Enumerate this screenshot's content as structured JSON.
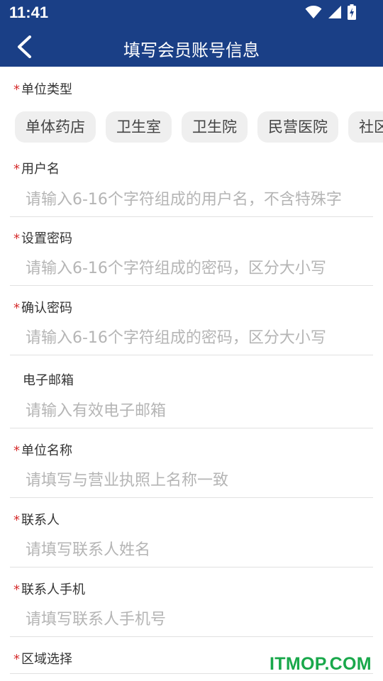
{
  "status": {
    "time": "11:41"
  },
  "header": {
    "title": "填写会员账号信息"
  },
  "form": {
    "unit_type": {
      "label": "单位类型",
      "options": [
        "单体药店",
        "卫生室",
        "卫生院",
        "民营医院",
        "社区"
      ]
    },
    "username": {
      "label": "用户名",
      "placeholder": "请输入6-16个字符组成的用户名，不含特殊字"
    },
    "password": {
      "label": "设置密码",
      "placeholder": "请输入6-16个字符组成的密码，区分大小写"
    },
    "confirm_password": {
      "label": "确认密码",
      "placeholder": "请输入6-16个字符组成的密码，区分大小写"
    },
    "email": {
      "label": "电子邮箱",
      "placeholder": "请输入有效电子邮箱"
    },
    "unit_name": {
      "label": "单位名称",
      "placeholder": "请填写与营业执照上名称一致"
    },
    "contact": {
      "label": "联系人",
      "placeholder": "请填写联系人姓名"
    },
    "contact_phone": {
      "label": "联系人手机",
      "placeholder": "请填写联系人手机号"
    },
    "region": {
      "label": "区域选择"
    },
    "required_mark": "*"
  },
  "watermark": "ITMOP.COM",
  "colors": {
    "primary": "#1a3f86",
    "required": "#d52b2b",
    "watermark": "#19a84b"
  }
}
